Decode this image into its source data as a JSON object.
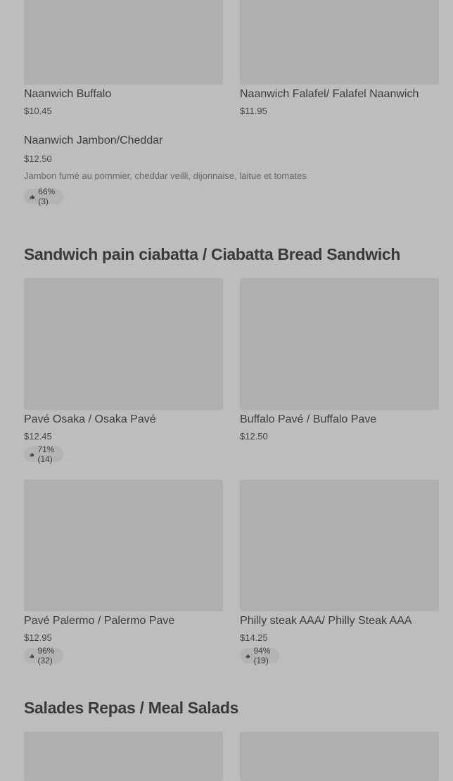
{
  "items_top": [
    {
      "name": "Naanwich Buffalo",
      "price": "$10.45"
    },
    {
      "name": "Naanwich Falafel/ Falafel Naanwich",
      "price": "$11.95"
    }
  ],
  "jambon": {
    "name": "Naanwich Jambon/Cheddar",
    "price": "$12.50",
    "description": "Jambon fumé au pommier, cheddar veilli, dijonnaise, laitue et tomates",
    "rating": "66% (3)"
  },
  "ciabatta": {
    "title": "Sandwich pain ciabatta / Ciabatta Bread Sandwich",
    "items": [
      {
        "name": "Pavé Osaka / Osaka Pavé",
        "price": "$12.45",
        "rating": "71% (14)"
      },
      {
        "name": "Buffalo Pavé / Buffalo Pave",
        "price": "$12.50"
      },
      {
        "name": "Pavé Palermo / Palermo Pave",
        "price": "$12.95",
        "rating": "96% (32)"
      },
      {
        "name": "Philly steak AAA/ Philly Steak AAA",
        "price": "$14.25",
        "rating": "94% (19)"
      }
    ]
  },
  "salads": {
    "title": "Salades Repas / Meal Salads"
  },
  "icons": {
    "rating": "thumbs-up-icon"
  }
}
